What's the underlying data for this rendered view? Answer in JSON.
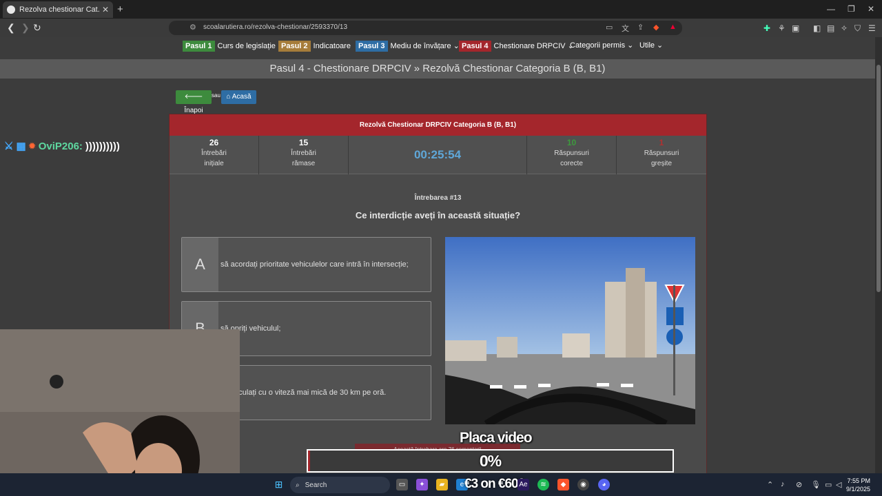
{
  "browser": {
    "tab_title": "Rezolva chestionar Cat. B (B, B1)",
    "url": "scoalarutiera.ro/rezolva-chestionar/2593370/13"
  },
  "site_nav": {
    "items": [
      {
        "step": "Pasul 1",
        "label": "Curs de legislație",
        "step_color": "#3d8b3d"
      },
      {
        "step": "Pasul 2",
        "label": "Indicatoare",
        "step_color": "#a67c3a"
      },
      {
        "step": "Pasul 3",
        "label": "Mediu de învățare ⌄",
        "step_color": "#2e6da4"
      },
      {
        "step": "Pasul 4",
        "label": "Chestionare DRPCIV ⌄",
        "step_color": "#a4262c"
      }
    ],
    "categories": "Categorii permis ⌄",
    "utils": "Utile ⌄"
  },
  "page_header": "Pasul 4 - Chestionare DRPCIV » Rezolvă Chestionar Categoria B (B, B1)",
  "actions": {
    "back": "🡐 Înapoi",
    "or": "sau",
    "home": "⌂ Acasă"
  },
  "quiz": {
    "title": "Rezolvă Chestionar DRPCIV Categoria B (B, B1)",
    "stats": {
      "initial_count": "26",
      "initial_label_1": "Întrebări",
      "initial_label_2": "inițiale",
      "remaining_count": "15",
      "remaining_label_1": "Întrebări",
      "remaining_label_2": "rămase",
      "timer": "00:25:54",
      "correct_count": "10",
      "correct_label_1": "Răspunsuri",
      "correct_label_2": "corecte",
      "wrong_count": "1",
      "wrong_label_1": "Răspunsuri",
      "wrong_label_2": "greșite"
    },
    "question_number": "Întrebarea #13",
    "question": "Ce interdicție aveți în această situație?",
    "answers": [
      {
        "letter": "A",
        "text": "să acordați prioritate vehiculelor care intră în intersecție;"
      },
      {
        "letter": "B",
        "text": "să opriți vehiculul;"
      },
      {
        "letter": "C",
        "text": "să circulați cu o viteză mai mică de 30 km pe oră."
      }
    ],
    "comments": "Această întrebare are 76 comentarii"
  },
  "overlay": {
    "chat_user": "OviP206:",
    "chat_message": "))))))))))",
    "placa": "Placa video",
    "progress_text": "0%",
    "progress_value": 0.005,
    "money": "€3 on €600"
  },
  "taskbar": {
    "search": "Search",
    "time": "7:55 PM",
    "date": "9/1/2025"
  }
}
